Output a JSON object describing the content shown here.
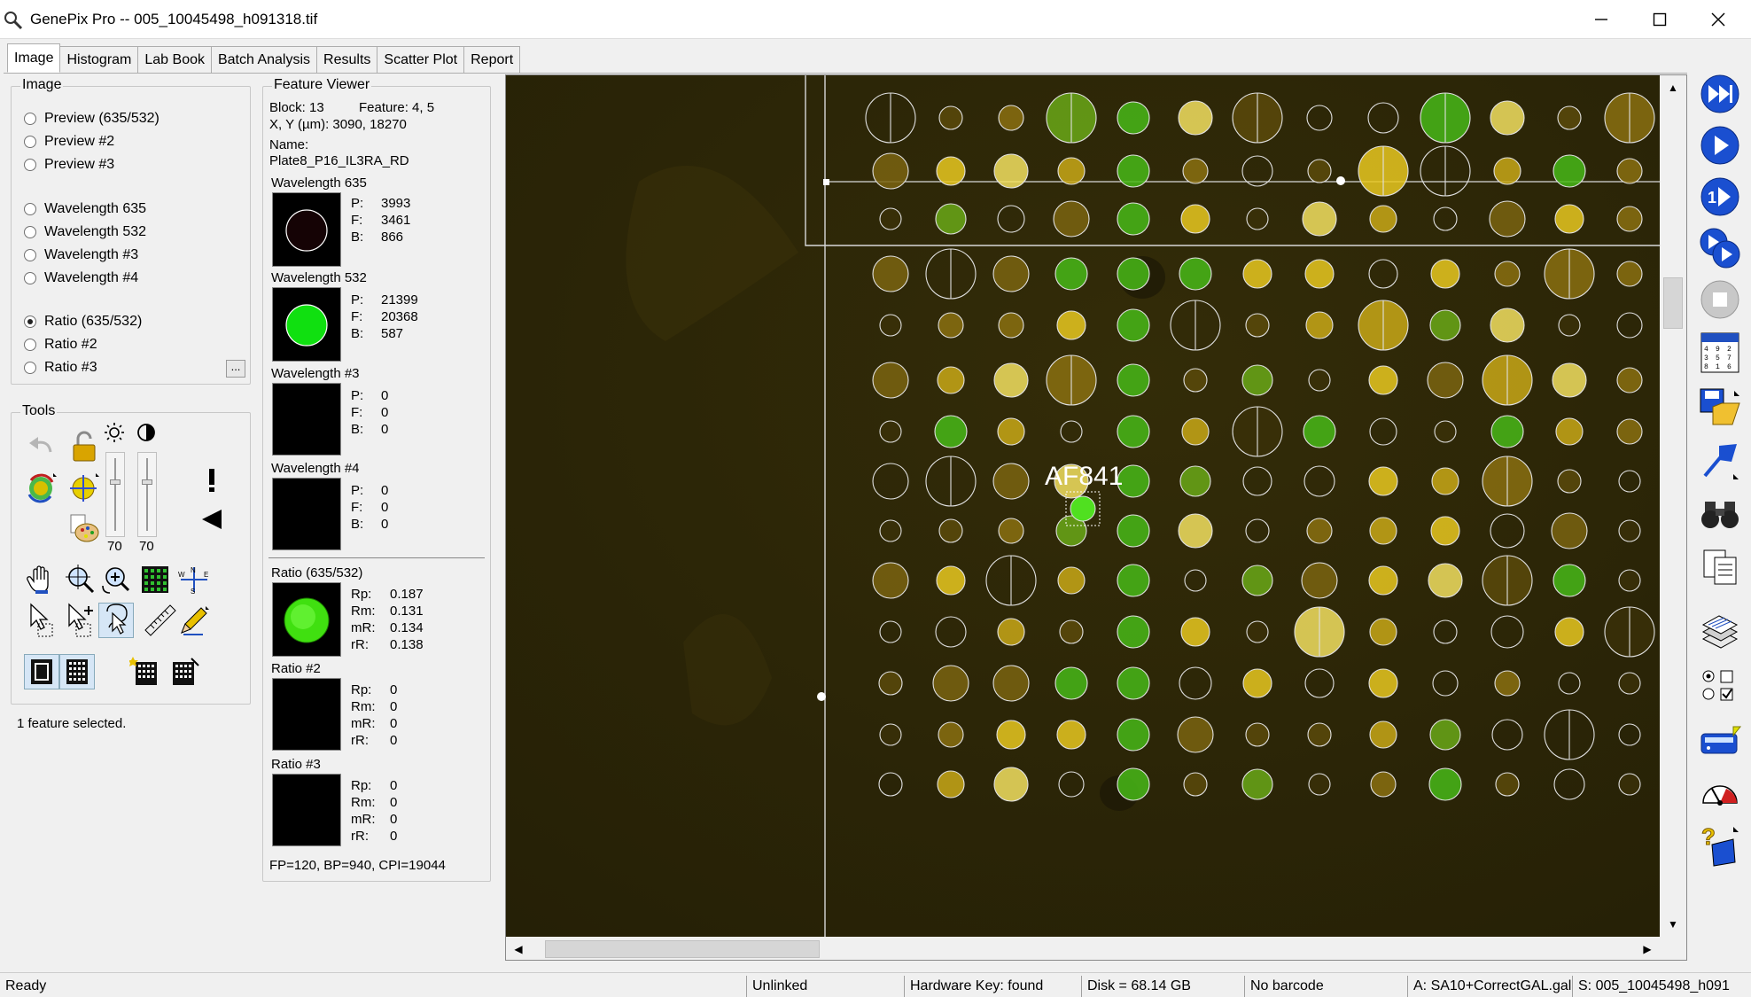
{
  "window": {
    "title": "GenePix Pro -- 005_10045498_h091318.tif",
    "app_icon": "magnifier-icon"
  },
  "tabs": [
    {
      "label": "Image",
      "active": true
    },
    {
      "label": "Histogram"
    },
    {
      "label": "Lab Book"
    },
    {
      "label": "Batch Analysis"
    },
    {
      "label": "Results"
    },
    {
      "label": "Scatter Plot"
    },
    {
      "label": "Report"
    }
  ],
  "image_group": {
    "label": "Image",
    "options": [
      "Preview (635/532)",
      "Preview #2",
      "Preview #3",
      "Wavelength 635",
      "Wavelength 532",
      "Wavelength #3",
      "Wavelength #4",
      "Ratio (635/532)",
      "Ratio #2",
      "Ratio #3"
    ],
    "selected": "Ratio (635/532)",
    "more_button": "..."
  },
  "tools_group": {
    "label": "Tools",
    "brightness_value": "70",
    "contrast_value": "70"
  },
  "status_message": "1 feature selected.",
  "feature_viewer": {
    "label": "Feature Viewer",
    "block": "Block: 13",
    "feature": "Feature:  4, 5",
    "xy": "X, Y (µm): 3090, 18270",
    "name_label": "Name:",
    "name": "Plate8_P16_IL3RA_RD",
    "channels": [
      {
        "title": "Wavelength 635",
        "rows": [
          [
            "P:",
            "3993"
          ],
          [
            "F:",
            "3461"
          ],
          [
            "B:",
            "866"
          ]
        ]
      },
      {
        "title": "Wavelength 532",
        "rows": [
          [
            "P:",
            "21399"
          ],
          [
            "F:",
            "20368"
          ],
          [
            "B:",
            "587"
          ]
        ]
      },
      {
        "title": "Wavelength #3",
        "rows": [
          [
            "P:",
            "0"
          ],
          [
            "F:",
            "0"
          ],
          [
            "B:",
            "0"
          ]
        ]
      },
      {
        "title": "Wavelength #4",
        "rows": [
          [
            "P:",
            "0"
          ],
          [
            "F:",
            "0"
          ],
          [
            "B:",
            "0"
          ]
        ]
      }
    ],
    "ratios": [
      {
        "title": "Ratio (635/532)",
        "rows": [
          [
            "Rp:",
            "0.187"
          ],
          [
            "Rm:",
            "0.131"
          ],
          [
            "mR:",
            "0.134"
          ],
          [
            "rR:",
            "0.138"
          ]
        ]
      },
      {
        "title": "Ratio #2",
        "rows": [
          [
            "Rp:",
            "0"
          ],
          [
            "Rm:",
            "0"
          ],
          [
            "mR:",
            "0"
          ],
          [
            "rR:",
            "0"
          ]
        ]
      },
      {
        "title": "Ratio #3",
        "rows": [
          [
            "Rp:",
            "0"
          ],
          [
            "Rm:",
            "0"
          ],
          [
            "mR:",
            "0"
          ],
          [
            "rR:",
            "0"
          ]
        ]
      }
    ],
    "footer": "FP=120, BP=940, CPI=19044"
  },
  "image_view": {
    "annotation": "AF841",
    "hscroll_fraction": 0.24,
    "vscroll_fraction": 0.26
  },
  "statusbar": [
    "Ready",
    "Unlinked",
    "Hardware Key: found",
    "Disk = 68.14 GB",
    "No barcode",
    "A: SA10+CorrectGAL.gal",
    "S: 005_10045498_h091"
  ],
  "right_toolbar": [
    "fast-forward-icon",
    "play-icon",
    "step-play-icon",
    "multi-play-icon",
    "stop-icon",
    "barcode-grid-icon",
    "save-open-icon",
    "flag-icon",
    "binoculars-icon",
    "copy-icon",
    "layers-icon",
    "checkbox-options-icon",
    "scanner-icon",
    "gauge-icon",
    "help-book-icon"
  ]
}
